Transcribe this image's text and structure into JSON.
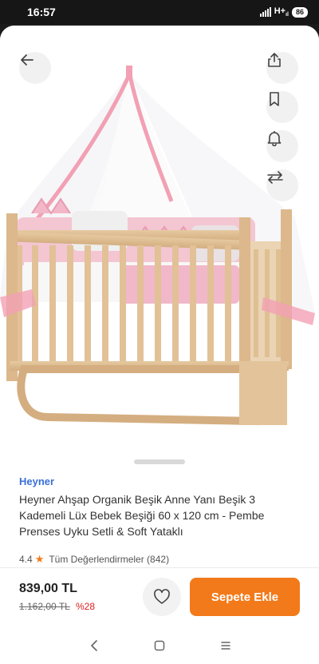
{
  "status_bar": {
    "time": "16:57",
    "network": "H+",
    "network_sub": "ıl",
    "battery": "86"
  },
  "product_image": {
    "icons": {
      "back": "arrow-left-icon",
      "share": "share-icon",
      "bookmark": "bookmark-icon",
      "alarm": "bell-icon",
      "compare": "compare-arrows-icon"
    }
  },
  "product": {
    "brand": "Heyner",
    "title": "Heyner Ahşap Organik Beşik Anne Yanı Beşik 3 Kademeli Lüx Bebek Beşiği 60 x 120 cm - Pembe Prenses Uyku Setli & Soft Yataklı",
    "rating": "4.4",
    "reviews_label": "Tüm Değerlendirmeler (842)"
  },
  "purchase": {
    "price": "839,00 TL",
    "old_price": "1.162,00 TL",
    "discount": "%28",
    "add_to_cart": "Sepete Ekle"
  },
  "colors": {
    "accent": "#f27a1a",
    "brand": "#3a6fd8",
    "discount": "#e02020"
  }
}
